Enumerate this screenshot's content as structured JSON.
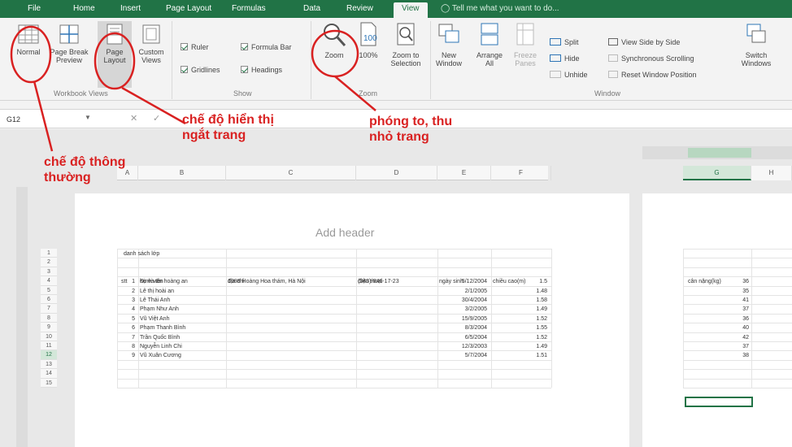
{
  "tabs": [
    {
      "label": "File"
    },
    {
      "label": "Home"
    },
    {
      "label": "Insert"
    },
    {
      "label": "Page Layout"
    },
    {
      "label": "Formulas"
    },
    {
      "label": "Data"
    },
    {
      "label": "Review"
    },
    {
      "label": "View"
    }
  ],
  "tellme": "Tell me what you want to do...",
  "ribbon": {
    "workbook_views": {
      "normal": "Normal",
      "page_break_1": "Page Break",
      "page_break_2": "Preview",
      "page_layout_1": "Page",
      "page_layout_2": "Layout",
      "custom_1": "Custom",
      "custom_2": "Views",
      "group": "Workbook Views"
    },
    "show": {
      "ruler": "Ruler",
      "formula_bar": "Formula Bar",
      "gridlines": "Gridlines",
      "headings": "Headings",
      "group": "Show"
    },
    "zoom": {
      "zoom": "Zoom",
      "hundred": "100%",
      "zoom_sel_1": "Zoom to",
      "zoom_sel_2": "Selection",
      "group": "Zoom"
    },
    "window": {
      "new_1": "New",
      "new_2": "Window",
      "arrange_1": "Arrange",
      "arrange_2": "All",
      "freeze_1": "Freeze",
      "freeze_2": "Panes",
      "split": "Split",
      "hide": "Hide",
      "unhide": "Unhide",
      "side_by_side": "View Side by Side",
      "sync": "Synchronous Scrolling",
      "reset": "Reset Window Position",
      "switch_1": "Switch",
      "switch_2": "Windows",
      "group": "Window"
    }
  },
  "name_box": "G12",
  "add_header": "Add header",
  "annotations": {
    "normal": [
      "chế độ thông",
      "thường"
    ],
    "page_layout": [
      "chế độ hiển thị",
      "ngắt trang"
    ],
    "zoom": [
      "phóng to, thu",
      "nhỏ trang"
    ]
  },
  "col_headers": [
    "A",
    "B",
    "C",
    "D",
    "E",
    "F"
  ],
  "right_col_headers": [
    "G",
    "H"
  ],
  "row_numbers": [
    "1",
    "2",
    "3",
    "4",
    "5",
    "6",
    "7",
    "8",
    "9",
    "10",
    "11",
    "12",
    "13",
    "14",
    "15"
  ],
  "sheet": {
    "title": "danh sách lớp",
    "headers": [
      "stt",
      "họ và tên",
      "địa chỉ",
      "điện thoại",
      "ngày sinh",
      "chiều cao(m)"
    ],
    "rows": [
      [
        "1",
        "Đinh văn hoàng an",
        "1988 Hoàng Hoa thám, Hà Nội",
        "(043)-846-17-23",
        "5/12/2004",
        "1.5"
      ],
      [
        "2",
        "Lê thị hoài an",
        "",
        "",
        "2/1/2005",
        "1.48"
      ],
      [
        "3",
        "Lê Thái Anh",
        "",
        "",
        "30/4/2004",
        "1.58"
      ],
      [
        "4",
        "Phạm Như Anh",
        "",
        "",
        "3/2/2005",
        "1.49"
      ],
      [
        "5",
        "Vũ Việt Anh",
        "",
        "",
        "15/9/2005",
        "1.52"
      ],
      [
        "6",
        "Phạm Thanh Bình",
        "",
        "",
        "8/3/2004",
        "1.55"
      ],
      [
        "7",
        "Trần Quốc Bình",
        "",
        "",
        "6/5/2004",
        "1.52"
      ],
      [
        "8",
        "Nguyễn Linh Chi",
        "",
        "",
        "12/3/2003",
        "1.49"
      ],
      [
        "9",
        "Vũ Xuân Cương",
        "",
        "",
        "5/7/2004",
        "1.51"
      ]
    ],
    "right_header": "cân nặng(kg)",
    "right_values": [
      "36",
      "35",
      "41",
      "37",
      "36",
      "40",
      "42",
      "37",
      "38"
    ]
  },
  "colors": {
    "accent": "#217346",
    "annotation": "#d92121"
  }
}
